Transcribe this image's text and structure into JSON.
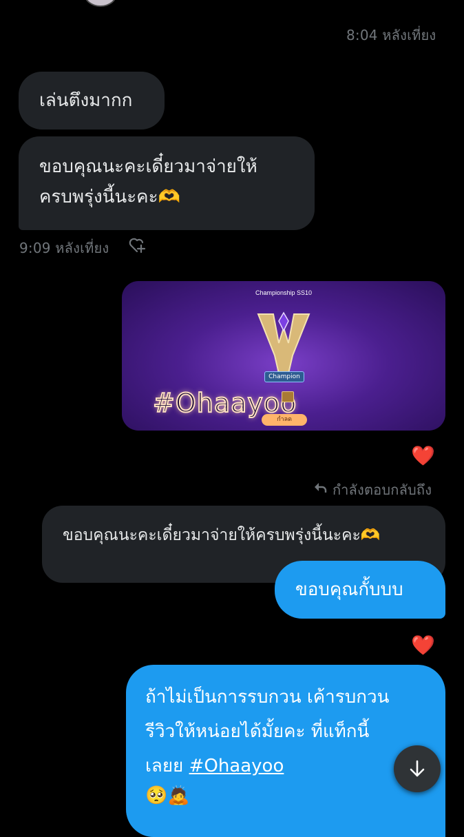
{
  "thread": {
    "timestamp_top": "8:04 หลังเที่ยง",
    "messages_in": [
      "เล่นตึงมากก",
      "ขอบคุณนะคะเดี๋ยวมาจ่ายให้",
      "ครบพรุ่งนี้นะคะ🫶"
    ],
    "timestamp_in": "9:09 หลังเที่ยง",
    "image": {
      "banner_title": "Championship SS10",
      "badge": "Champion",
      "watermark": "#Ohaayoo",
      "button_label": "กำลด"
    },
    "reaction_1": "❤️",
    "reply_context": "กำลังตอบกลับถึง",
    "quoted_message": "ขอบคุณนะคะเดี๋ยวมาจ่ายให้ครบพรุ่งนี้นะคะ🫶",
    "reply_message": "ขอบคุณกั้บบบ",
    "reaction_2": "❤️",
    "last_message": {
      "line1": "ถ้าไม่เป็นการรบกวน เค้ารบกวน",
      "line2": "รีวิวให้หน่อยได้มั้ยคะ ที่แท็กนี้",
      "line3_prefix": "เลยย ",
      "hashtag": "#Ohaayoo",
      "emoji": "🥺🙇"
    }
  },
  "colors": {
    "background": "#000000",
    "incoming_bubble": "#202327",
    "outgoing_bubble": "#1d9bf0",
    "timestamp": "#71767b",
    "heart": "#f91880"
  },
  "icons": {
    "add_reaction": "heart-plus-icon",
    "reply": "reply-arrow-icon",
    "scroll_down": "arrow-down-icon"
  }
}
